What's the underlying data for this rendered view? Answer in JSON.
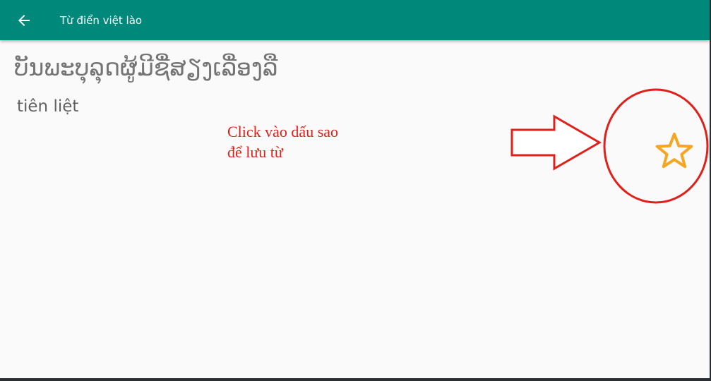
{
  "appbar": {
    "title": "Từ điển việt lào",
    "back_icon": "arrow-left-icon",
    "color": "#00897b"
  },
  "entry": {
    "lao_word": "ບັນພະບຸລຸດຜູ້ມີຊື່ສຽງເລື່ອງລື",
    "meaning": "tiên liệt",
    "favorite_icon": "star-outline-icon",
    "star_color": "#f5a623"
  },
  "annotation": {
    "hint_line1": "Click vào dấu sao",
    "hint_line2": "để lưu từ",
    "color": "#e0201a"
  }
}
